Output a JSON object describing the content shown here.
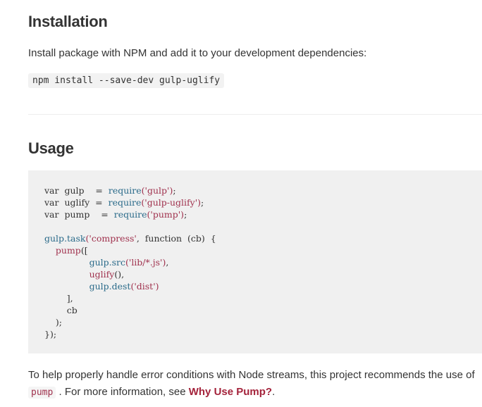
{
  "installation": {
    "heading": "Installation",
    "description": "Install package with NPM and add it to your development dependencies:",
    "command": "npm install --save-dev gulp-uglify"
  },
  "usage": {
    "heading": "Usage",
    "code": {
      "line1_var": "var",
      "line1_name": "gulp",
      "line1_eq": "=",
      "line1_req": "require",
      "line1_arg": "('gulp')",
      "line1_end": ";",
      "line2_var": "var",
      "line2_name": "uglify",
      "line2_eq": "=",
      "line2_req": "require",
      "line2_arg": "('gulp-uglify')",
      "line2_end": ";",
      "line3_var": "var",
      "line3_name": "pump",
      "line3_eq": "=",
      "line3_req": "require",
      "line3_arg": "('pump')",
      "line3_end": ";",
      "task_obj": "gulp",
      "task_method": ".task",
      "task_arg": "('compress'",
      "task_rest": ",  function  (cb)  {",
      "pump_call": "pump",
      "pump_open": "([",
      "src_call": "gulp.src",
      "src_arg": "('lib/*.js')",
      "src_end": ",",
      "uglify_call": "uglify",
      "uglify_end": "(),",
      "dest_call": "gulp.dest",
      "dest_arg": "('dist')",
      "close_arr": "],",
      "cb": "cb",
      "close_pump": ");",
      "close_task": "});"
    }
  },
  "footer": {
    "text_before": "To help properly handle error conditions with Node streams, this project recommends the use of",
    "code": "pump",
    "text_middle": ". For more information, see",
    "link": "Why Use Pump?",
    "text_end": "."
  },
  "colors": {
    "accent_link": "#a4233b",
    "code_string": "#a0324e",
    "code_function": "#2b6b8a",
    "code_background": "#f0f0f0"
  }
}
